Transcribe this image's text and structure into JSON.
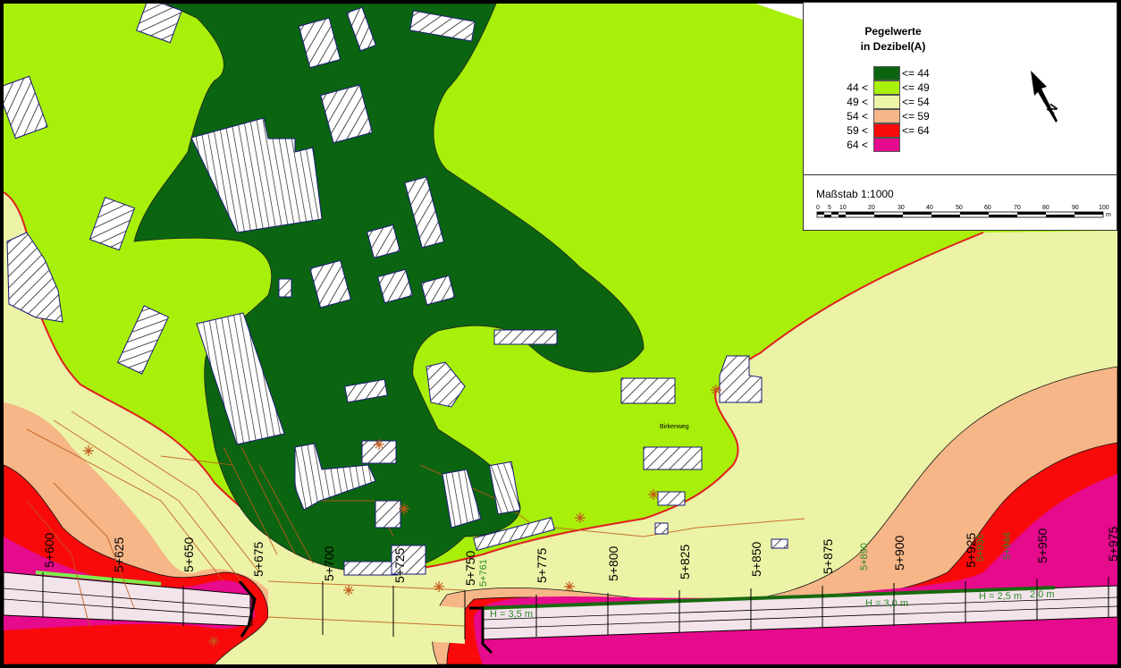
{
  "legend": {
    "title_line1": "Pegelwerte",
    "title_line2": "in Dezibel(A)",
    "classes": [
      {
        "lower": "",
        "upper": "<= 44",
        "color": "#0b6410"
      },
      {
        "lower": "44 <",
        "upper": "<= 49",
        "color": "#a8ef0a"
      },
      {
        "lower": "49 <",
        "upper": "<= 54",
        "color": "#ecf3a6"
      },
      {
        "lower": "54 <",
        "upper": "<= 59",
        "color": "#f6b687"
      },
      {
        "lower": "59 <",
        "upper": "<= 64",
        "color": "#f80a0a"
      },
      {
        "lower": "64 <",
        "upper": "",
        "color": "#e60a8c"
      }
    ],
    "scale_label": "Maßstab 1:1000",
    "scale_ticks": [
      "0",
      "5",
      "10",
      "20",
      "30",
      "40",
      "50",
      "60",
      "70",
      "80",
      "90",
      "100"
    ],
    "scale_unit": "m",
    "north_label": "N"
  },
  "map": {
    "street_labels": [
      "Birkenweg"
    ],
    "stations": [
      "5+600",
      "5+625",
      "5+650",
      "5+675",
      "5+700",
      "5+725",
      "5+750",
      "5+775",
      "5+800",
      "5+825",
      "5+850",
      "5+875",
      "5+900",
      "5+925",
      "5+950",
      "5+975"
    ],
    "wall_stations": [
      "5+761",
      "5+890",
      "5+930",
      "5+944"
    ],
    "wall_heights": [
      "H = 3,5 m",
      "H = 3,0 m",
      "H = 2,5 m",
      "2,0 m"
    ]
  }
}
